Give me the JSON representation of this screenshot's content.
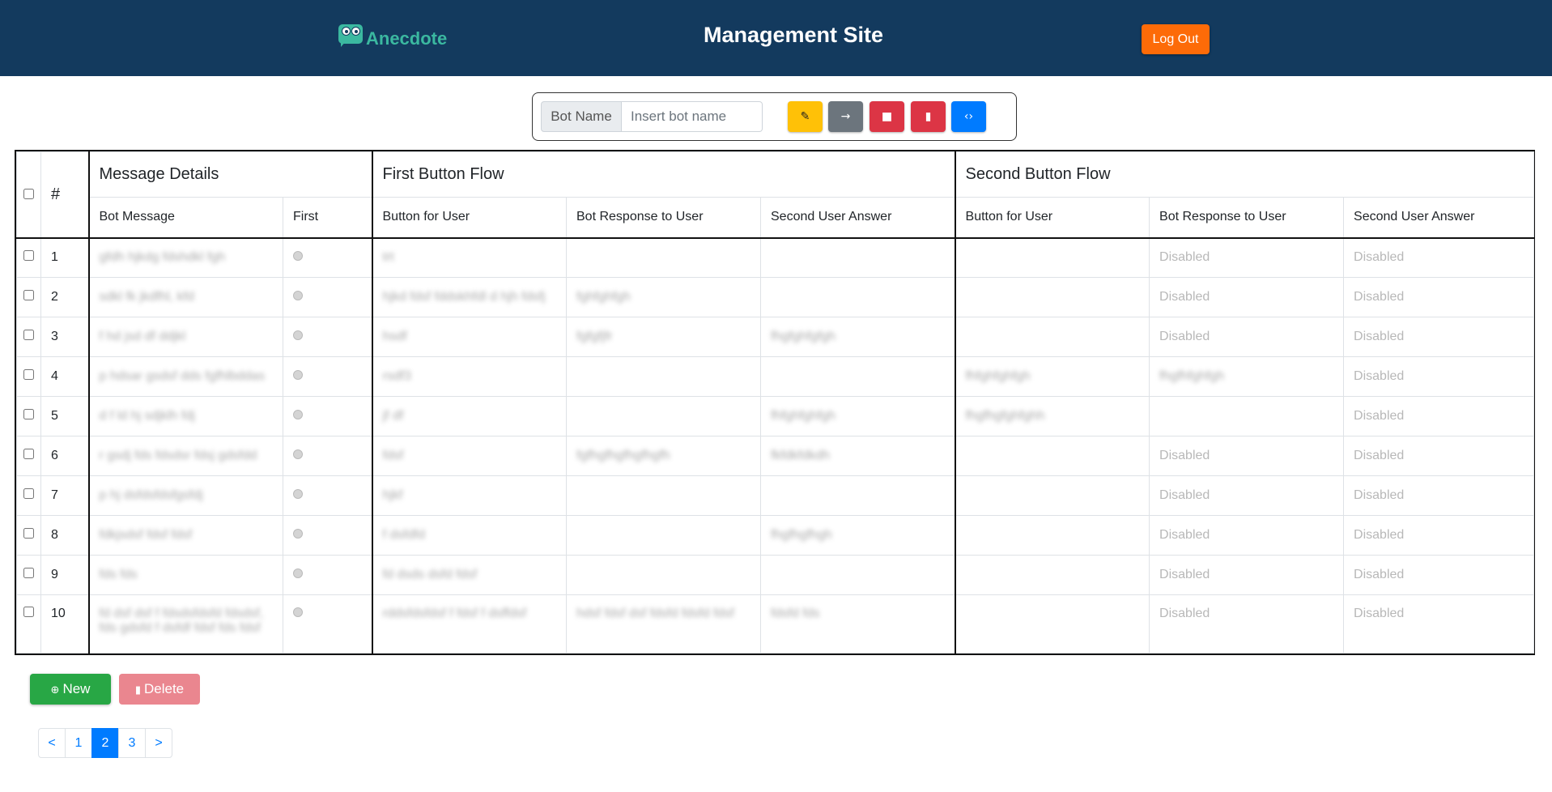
{
  "header": {
    "logo_text": "Anecdote",
    "title": "Management Site",
    "logout_label": "Log Out"
  },
  "toolbar": {
    "bot_name_label": "Bot Name",
    "bot_name_placeholder": "Insert bot name",
    "buttons": [
      "pencil-icon",
      "arrow-right-icon",
      "save-icon",
      "trash-icon",
      "code-icon"
    ]
  },
  "table": {
    "groups": {
      "hash": "#",
      "message_details": "Message Details",
      "first_flow": "First Button Flow",
      "second_flow": "Second Button Flow"
    },
    "columns": {
      "bot_message": "Bot Message",
      "first": "First",
      "button_for_user_1": "Button for User",
      "bot_response_1": "Bot Response to User",
      "second_answer_1": "Second User Answer",
      "button_for_user_2": "Button for User",
      "bot_response_2": "Bot Response to User",
      "second_answer_2": "Second User Answer"
    },
    "rows": [
      {
        "num": "1",
        "msg": "gfdh hjkdg fdshdkl fgh",
        "b1": "trt",
        "r1": "",
        "a1": "",
        "b2": "",
        "r2": "Disabled",
        "a2": "Disabled"
      },
      {
        "num": "2",
        "msg": "sdkl fk jkdfhl, kfd",
        "b1": "hjkd fdsf fddskhfdl d hjh fdsfj",
        "r1": "fghfghfgh",
        "a1": "",
        "b2": "",
        "r2": "Disabled",
        "a2": "Disabled"
      },
      {
        "num": "3",
        "msg": "f hd jsd df ddjkl",
        "b1": "hsdf",
        "r1": "fgfgfjfr",
        "a1": "fhgfghfgfgh",
        "b2": "",
        "r2": "Disabled",
        "a2": "Disabled"
      },
      {
        "num": "4",
        "msg": "p hdsar gsdsf dds fgfhlbddas",
        "b1": "rsdf3",
        "r1": "",
        "a1": "",
        "b2": "fhfghfghfgh",
        "r2": "fhgfhfghfgh",
        "a2": "Disabled"
      },
      {
        "num": "5",
        "msg": "d f ld hj sdjklh fdj",
        "b1": "jf df",
        "r1": "",
        "a1": "fhfghfghfgh",
        "b2": "fhgfhgfghfghh",
        "r2": "",
        "a2": "Disabled"
      },
      {
        "num": "6",
        "msg": "r gsdj fds fdsdsr fdsj gdsfdd",
        "b1": "fdsf",
        "r1": "fgfhgfhgfhgfhgfh",
        "a1": "fkfdkfdkdh",
        "b2": "",
        "r2": "Disabled",
        "a2": "Disabled"
      },
      {
        "num": "7",
        "msg": "p hj dsfdsfdsfgsfdj",
        "b1": "hjkf",
        "r1": "",
        "a1": "",
        "b2": "",
        "r2": "Disabled",
        "a2": "Disabled"
      },
      {
        "num": "8",
        "msg": "fdkjsdsf fdsf fdsf",
        "b1": "f dsfdfd",
        "r1": "",
        "a1": "fhgfhgfhgh",
        "b2": "",
        "r2": "Disabled",
        "a2": "Disabled"
      },
      {
        "num": "9",
        "msg": "fds fds",
        "b1": "fd dsds dsfd fdsf",
        "r1": "",
        "a1": "",
        "b2": "",
        "r2": "Disabled",
        "a2": "Disabled"
      },
      {
        "num": "10",
        "msg": "fd dsf dsf f fdsdsfdsfd fdsdsf, fds gdsfd f dsfdf fdsf fds fdsf",
        "b1": "rddsfdsfdsf f fdsf f dsffdsf",
        "r1": "hdsf fdsf dsf fdsfd fdsfd fdsf",
        "a1": "fdsfd fds",
        "b2": "",
        "r2": "Disabled",
        "a2": "Disabled"
      }
    ]
  },
  "footer": {
    "new_label": "New",
    "delete_label": "Delete"
  },
  "pagination": {
    "prev": "<",
    "pages": [
      "1",
      "2",
      "3"
    ],
    "active_page": "2",
    "next": ">"
  }
}
